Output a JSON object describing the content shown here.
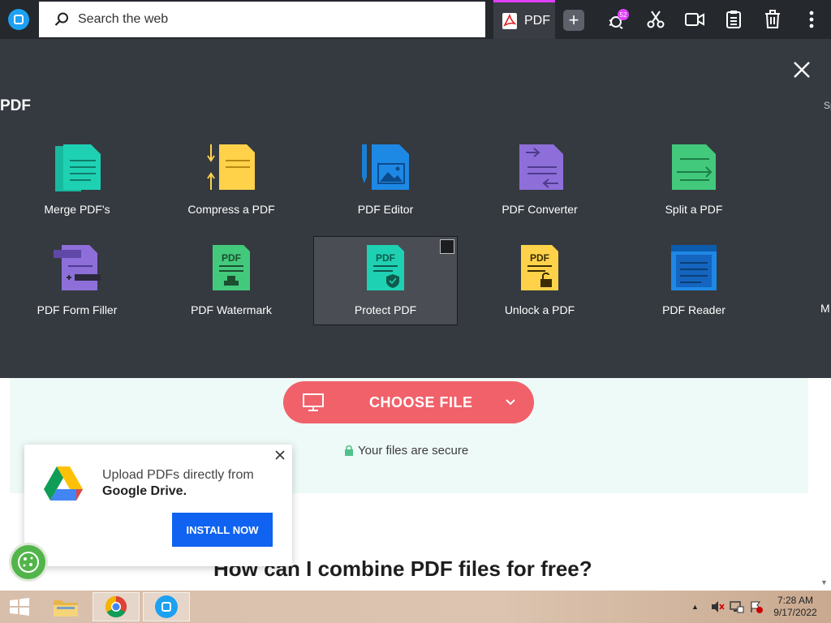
{
  "topbar": {
    "search_placeholder": "Search the web",
    "active_tab": "PDF",
    "notification_badge": "52"
  },
  "panel": {
    "title": "PDF",
    "edge_right_label": "Sp",
    "edge_right_label_2": "M",
    "tools": [
      {
        "label": "Merge PDF's",
        "icon": "merge-pdf-icon",
        "color": "#1fc9ad"
      },
      {
        "label": "Compress a PDF",
        "icon": "compress-pdf-icon",
        "color": "#ffc83d"
      },
      {
        "label": "PDF Editor",
        "icon": "pdf-editor-icon",
        "color": "#1a7fd4"
      },
      {
        "label": "PDF Converter",
        "icon": "pdf-converter-icon",
        "color": "#8a6bd8"
      },
      {
        "label": "Split a PDF",
        "icon": "split-pdf-icon",
        "color": "#3ec97a"
      },
      {
        "label": "PDF Form Filler",
        "icon": "pdf-form-filler-icon",
        "color": "#8a6bd8"
      },
      {
        "label": "PDF Watermark",
        "icon": "pdf-watermark-icon",
        "color": "#3ec97a"
      },
      {
        "label": "Protect PDF",
        "icon": "protect-pdf-icon",
        "color": "#1fc9ad"
      },
      {
        "label": "Unlock a PDF",
        "icon": "unlock-pdf-icon",
        "color": "#ffc83d"
      },
      {
        "label": "PDF Reader",
        "icon": "pdf-reader-icon",
        "color": "#1a7fd4"
      }
    ]
  },
  "content": {
    "choose_file": "CHOOSE FILE",
    "secure_text": "Your files are secure",
    "heading": "How can I combine PDF files for free?"
  },
  "popup": {
    "line1": "Upload PDFs directly from",
    "line2": "Google Drive.",
    "install": "INSTALL NOW"
  },
  "taskbar": {
    "time": "7:28 AM",
    "date": "9/17/2022"
  },
  "colors": {
    "choose_button": "#f0616a",
    "install_button": "#0f63f0",
    "panel_bg": "#353a40"
  }
}
